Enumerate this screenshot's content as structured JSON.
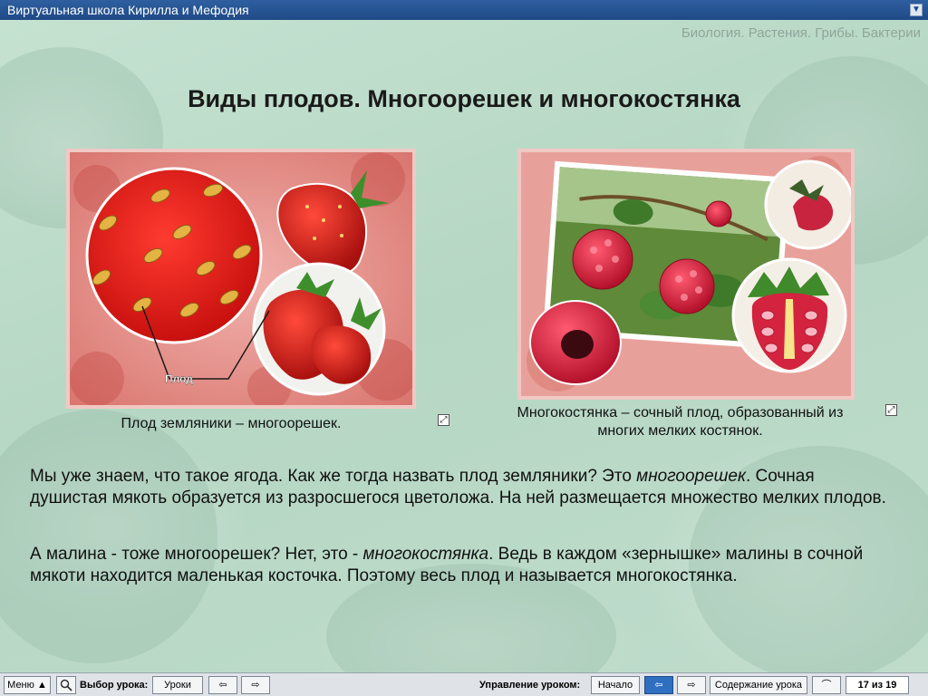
{
  "window": {
    "title": "Виртуальная школа Кирилла и Мефодия"
  },
  "header": {
    "breadcrumb": "Биология. Растения. Грибы. Бактерии"
  },
  "slide": {
    "title": "Виды плодов. Многоорешек и многокостянка"
  },
  "figures": [
    {
      "caption": "Плод земляники – многоорешек.",
      "label": "Плод"
    },
    {
      "caption_line1": "Многокостянка – сочный плод, образованный из",
      "caption_line2": "многих  мелких костянок."
    }
  ],
  "paragraphs": [
    {
      "before": "Мы уже знаем, что такое ягода. Как же тогда назвать плод земляники? Это ",
      "term": "многоорешек",
      "after": ". Сочная душистая мякоть образуется из разросшегося цветоложа. На ней размещается множество мелких плодов."
    },
    {
      "before": "А малина - тоже многоорешек? Нет, это - ",
      "term": "многокостянка",
      "after": ". Ведь в каждом «зернышке» малины в сочной мякоти находится маленькая косточка. Поэтому весь плод и называется многокостянка."
    }
  ],
  "toolbar": {
    "menu": "Меню ▲",
    "lesson_select_label": "Выбор урока:",
    "lessons_button": "Уроки",
    "lesson_control_label": "Управление уроком:",
    "start_button": "Начало",
    "contents_button": "Содержание урока",
    "page_counter": "17 из 19"
  },
  "icons": {
    "collapse": "chevron-down-icon",
    "zoom": "expand-icon",
    "search": "magnifier-icon",
    "prev": "arrow-left-icon",
    "next": "arrow-right-icon"
  },
  "colors": {
    "titlebar": "#1f4a86",
    "active_button": "#2f6fbf",
    "frame": "#f0c8c4"
  }
}
